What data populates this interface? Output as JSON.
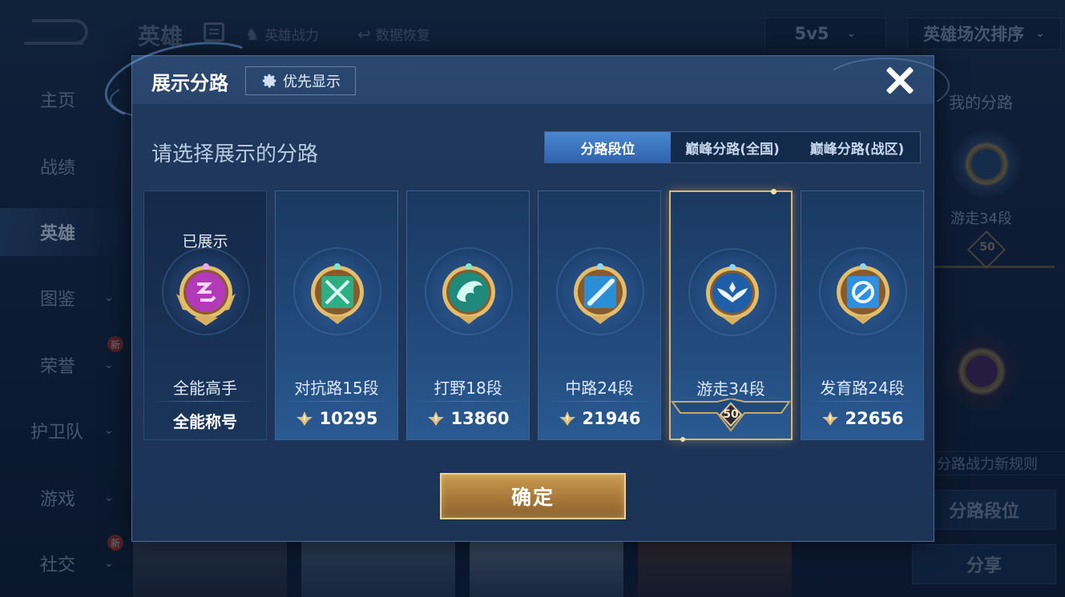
{
  "background": {
    "page_title": "英雄",
    "top_links": [
      {
        "label": "英雄战力",
        "icon": "helmet-icon"
      },
      {
        "label": "数据恢复",
        "icon": "restore-icon"
      }
    ],
    "mode_select": "5v5",
    "sort_select": "英雄场次排序",
    "nav": [
      {
        "label": "主页",
        "active": false
      },
      {
        "label": "战绩",
        "active": false
      },
      {
        "label": "英雄",
        "active": true
      },
      {
        "label": "图鉴",
        "active": false,
        "expand": true
      },
      {
        "label": "荣誉",
        "active": false,
        "expand": true,
        "new": "新"
      },
      {
        "label": "护卫队",
        "active": false,
        "expand": true
      },
      {
        "label": "游戏",
        "active": false,
        "expand": true
      },
      {
        "label": "社交",
        "active": false,
        "expand": true,
        "new": "新"
      }
    ],
    "right_panel": {
      "title": "我的分路",
      "badge_label": "游走34段",
      "level": "50",
      "rule_link": "分路战力新规则",
      "lane_button": "分路段位",
      "share_button": "分享"
    }
  },
  "modal": {
    "title": "展示分路",
    "priority_button": "优先显示",
    "prompt": "请选择展示的分路",
    "tabs": [
      {
        "label": "分路段位",
        "active": true
      },
      {
        "label": "巅峰分路(全国)",
        "active": false
      },
      {
        "label": "巅峰分路(战区)",
        "active": false
      }
    ],
    "cards": [
      {
        "status": "已展示",
        "name": "全能高手",
        "bottom": "全能称号",
        "kind": "title",
        "badge_color": "#b23ab8",
        "badge_icon": "allround-icon"
      },
      {
        "name": "对抗路15段",
        "power": "10295",
        "kind": "power",
        "badge_color": "#2fae86",
        "badge_icon": "clash-lane-icon"
      },
      {
        "name": "打野18段",
        "power": "13860",
        "kind": "power",
        "badge_color": "#1f8a7a",
        "badge_icon": "jungle-icon"
      },
      {
        "name": "中路24段",
        "power": "21946",
        "kind": "power",
        "badge_color": "#2a8fd6",
        "badge_icon": "mid-lane-icon"
      },
      {
        "name": "游走34段",
        "level": "50",
        "kind": "level",
        "selected": true,
        "badge_color": "#1f5ea8",
        "badge_icon": "roam-icon"
      },
      {
        "name": "发育路24段",
        "power": "22656",
        "kind": "power",
        "badge_color": "#2f8fe0",
        "badge_icon": "farm-lane-icon"
      }
    ],
    "confirm_button": "确定"
  }
}
